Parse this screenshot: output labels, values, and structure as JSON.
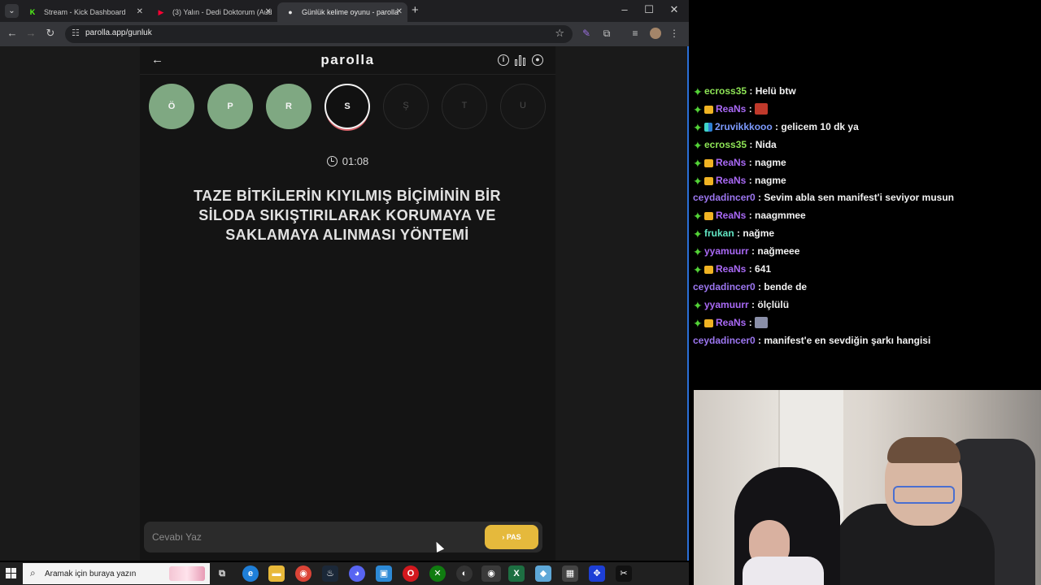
{
  "browser": {
    "tabs": [
      {
        "label": "Stream - Kick Dashboard",
        "favicon_text": "K",
        "favicon_color": "#53fc18"
      },
      {
        "label": "(3) Yalın - Dedi Doktorum (Aud",
        "favicon_text": "▶",
        "favicon_color": "#ff0033"
      },
      {
        "label": "Günlük kelime oyunu - parolla",
        "favicon_text": "●",
        "favicon_color": "#e8e8e8"
      }
    ],
    "url": "parolla.app/gunluk"
  },
  "game": {
    "logo": "parolla",
    "letters": [
      {
        "letter": "Ö",
        "state": "done"
      },
      {
        "letter": "P",
        "state": "done"
      },
      {
        "letter": "R",
        "state": "done"
      },
      {
        "letter": "S",
        "state": "current"
      },
      {
        "letter": "Ş",
        "state": "future"
      },
      {
        "letter": "T",
        "state": "future"
      },
      {
        "letter": "U",
        "state": "future"
      }
    ],
    "timer": "01:08",
    "question": "TAZE BİTKİLERİN KIYILMIŞ BİÇİMİNİN BİR SİLODA SIKIŞTIRILARAK KORUMAYA VE SAKLAMAYA ALINMASI YÖNTEMİ",
    "answer_placeholder": "Cevabı Yaz",
    "pass_label": "PAS"
  },
  "taskbar": {
    "search_placeholder": "Aramak için buraya yazın"
  },
  "chat": {
    "messages": [
      {
        "badges": [
          "plus"
        ],
        "user": "ecross35",
        "color": "u-green",
        "text": "Helü btw"
      },
      {
        "badges": [
          "plus",
          "crown"
        ],
        "user": "ReaNs",
        "color": "u-purple",
        "text": "",
        "emote": "#c0392b"
      },
      {
        "badges": [
          "plus",
          "grid"
        ],
        "user": "2ruvikkkooo",
        "color": "u-blue",
        "text": "gelicem 10 dk ya"
      },
      {
        "badges": [
          "plus"
        ],
        "user": "ecross35",
        "color": "u-green",
        "text": "Nida"
      },
      {
        "badges": [
          "plus",
          "crown"
        ],
        "user": "ReaNs",
        "color": "u-purple",
        "text": "nagme"
      },
      {
        "badges": [
          "plus",
          "crown"
        ],
        "user": "ReaNs",
        "color": "u-purple",
        "text": "nagme"
      },
      {
        "badges": [],
        "user": "ceydadincer0",
        "color": "u-violet",
        "text": "Sevim abla sen manifest'i seviyor musun"
      },
      {
        "badges": [
          "plus",
          "crown"
        ],
        "user": "ReaNs",
        "color": "u-purple",
        "text": "naagmmee"
      },
      {
        "badges": [
          "plus"
        ],
        "user": "frukan",
        "color": "u-mint",
        "text": "nağme"
      },
      {
        "badges": [
          "plus"
        ],
        "user": "yyamuurr",
        "color": "u-purple",
        "text": "nağmeee"
      },
      {
        "badges": [
          "plus",
          "crown"
        ],
        "user": "ReaNs",
        "color": "u-purple",
        "text": "641"
      },
      {
        "badges": [],
        "user": "ceydadincer0",
        "color": "u-violet",
        "text": "bende de"
      },
      {
        "badges": [
          "plus"
        ],
        "user": "yyamuurr",
        "color": "u-purple",
        "text": "ölçlülü"
      },
      {
        "badges": [
          "plus",
          "crown"
        ],
        "user": "ReaNs",
        "color": "u-purple",
        "text": "",
        "emote": "#8a8fa8"
      },
      {
        "badges": [],
        "user": "ceydadincer0",
        "color": "u-violet",
        "text": "manifest'e en sevdiğin şarkı hangisi"
      }
    ]
  }
}
